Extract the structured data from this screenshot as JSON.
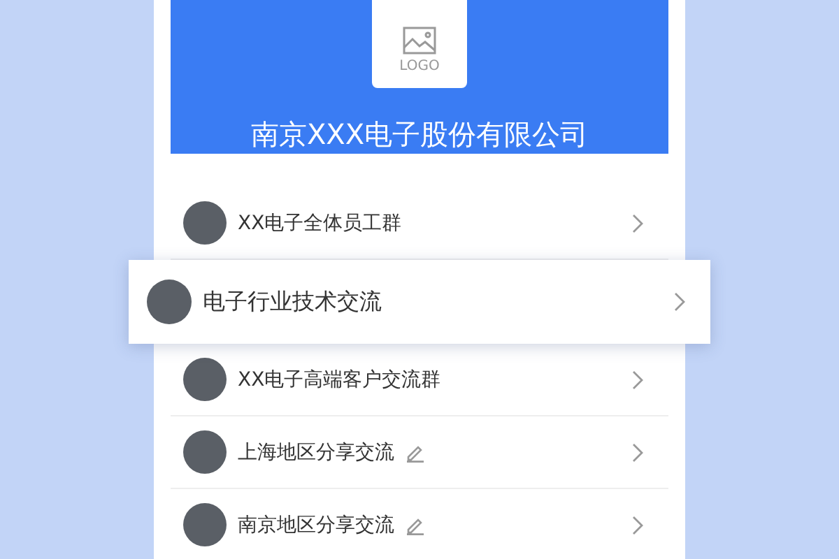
{
  "header": {
    "logo_label": "LOGO",
    "company_name": "南京XXX电子股份有限公司"
  },
  "groups": [
    {
      "name": "XX电子全体员工群",
      "raised": false,
      "editable": false
    },
    {
      "name": "电子行业技术交流",
      "raised": true,
      "editable": false
    },
    {
      "name": "XX电子高端客户交流群",
      "raised": false,
      "editable": false
    },
    {
      "name": "上海地区分享交流",
      "raised": false,
      "editable": true
    },
    {
      "name": "南京地区分享交流",
      "raised": false,
      "editable": true
    }
  ]
}
